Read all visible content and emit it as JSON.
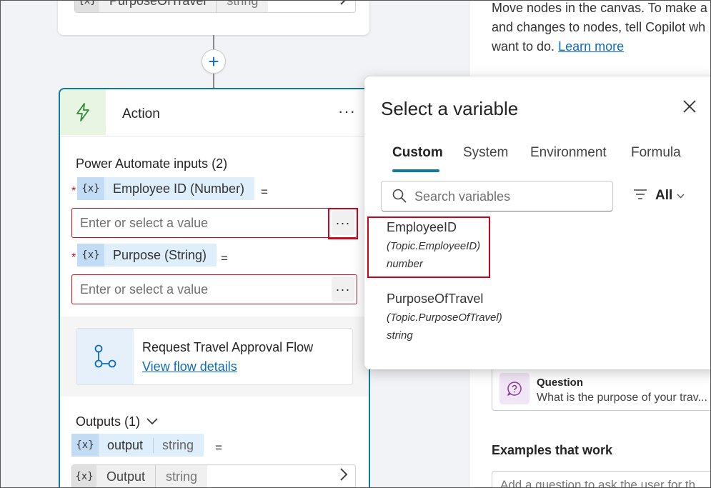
{
  "canvas": {
    "top_node": {
      "var_icon": "{x}",
      "var_name": "PurposeOfTravel",
      "var_type": "string"
    },
    "add_node_icon": "+",
    "action": {
      "title": "Action",
      "more_icon": "···",
      "inputs_label": "Power Automate inputs (2)",
      "params": [
        {
          "icon": "{x}",
          "label": "Employee ID (Number)",
          "equals": "=",
          "placeholder": "Enter or select a value",
          "required": "*",
          "more": "···"
        },
        {
          "icon": "{x}",
          "label": "Purpose (String)",
          "equals": "=",
          "placeholder": "Enter or select a value",
          "required": "*",
          "more": "···"
        }
      ],
      "flow": {
        "title": "Request Travel Approval Flow",
        "link": "View flow details"
      },
      "outputs_label": "Outputs (1)",
      "output_param": {
        "icon": "{x}",
        "name": "output",
        "type": "string",
        "equals": "="
      },
      "output_var": {
        "icon": "{x}",
        "name": "Output",
        "type": "string"
      }
    }
  },
  "right_panel": {
    "intro_lines": [
      "Move nodes in the canvas. To make a",
      "and changes to nodes, tell Copilot wh",
      "want to do."
    ],
    "learn_more": "Learn more",
    "question_card": {
      "title": "Question",
      "text": "What is the purpose of your trav..."
    },
    "examples_heading": "Examples that work",
    "examples_input": "Add a question to ask the user for th"
  },
  "popup": {
    "title": "Select a variable",
    "tabs": [
      "Custom",
      "System",
      "Environment",
      "Formula"
    ],
    "active_tab": "Custom",
    "search_placeholder": "Search variables",
    "filter_label": "All",
    "variables": [
      {
        "name": "EmployeeID",
        "path": "(Topic.EmployeeID)",
        "type": "number"
      },
      {
        "name": "PurposeOfTravel",
        "path": "(Topic.PurposeOfTravel)",
        "type": "string"
      }
    ]
  },
  "colors": {
    "accent": "#0f7b9a",
    "link": "#0f6cbd",
    "error": "#c50f1f",
    "highlight": "#d0021b"
  }
}
